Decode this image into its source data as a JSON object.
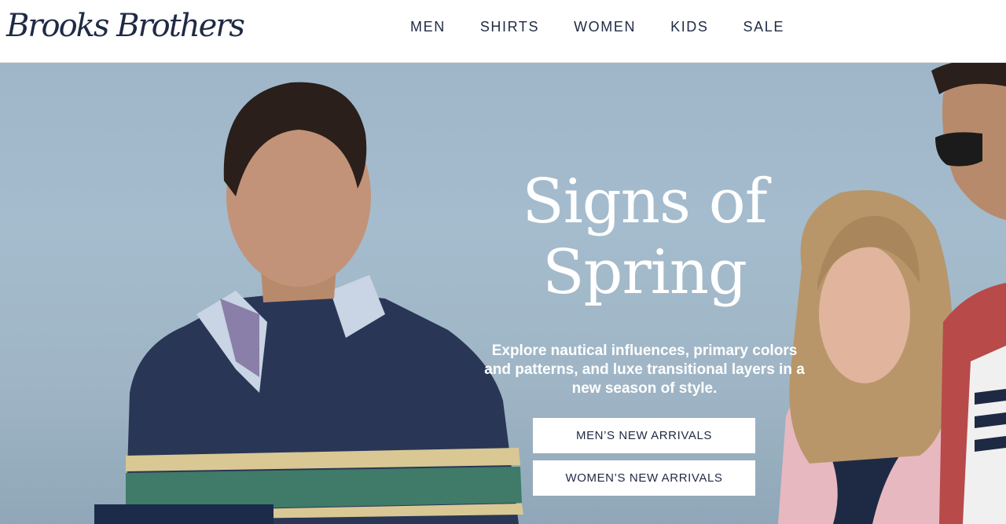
{
  "brand": {
    "logo_text": "Brooks Brothers"
  },
  "nav": {
    "items": [
      {
        "label": "MEN"
      },
      {
        "label": "SHIRTS"
      },
      {
        "label": "WOMEN"
      },
      {
        "label": "KIDS"
      },
      {
        "label": "SALE"
      }
    ]
  },
  "hero": {
    "headline_line1": "Signs of",
    "headline_line2": "Spring",
    "subtext": "Explore nautical influences, primary colors and patterns, and luxe transitional layers in a new season of style.",
    "cta_men": "MEN’S NEW ARRIVALS",
    "cta_women": "WOMEN’S NEW ARRIVALS"
  },
  "colors": {
    "navy": "#1f2a44",
    "sky": "#a4bccd",
    "white": "#ffffff"
  }
}
